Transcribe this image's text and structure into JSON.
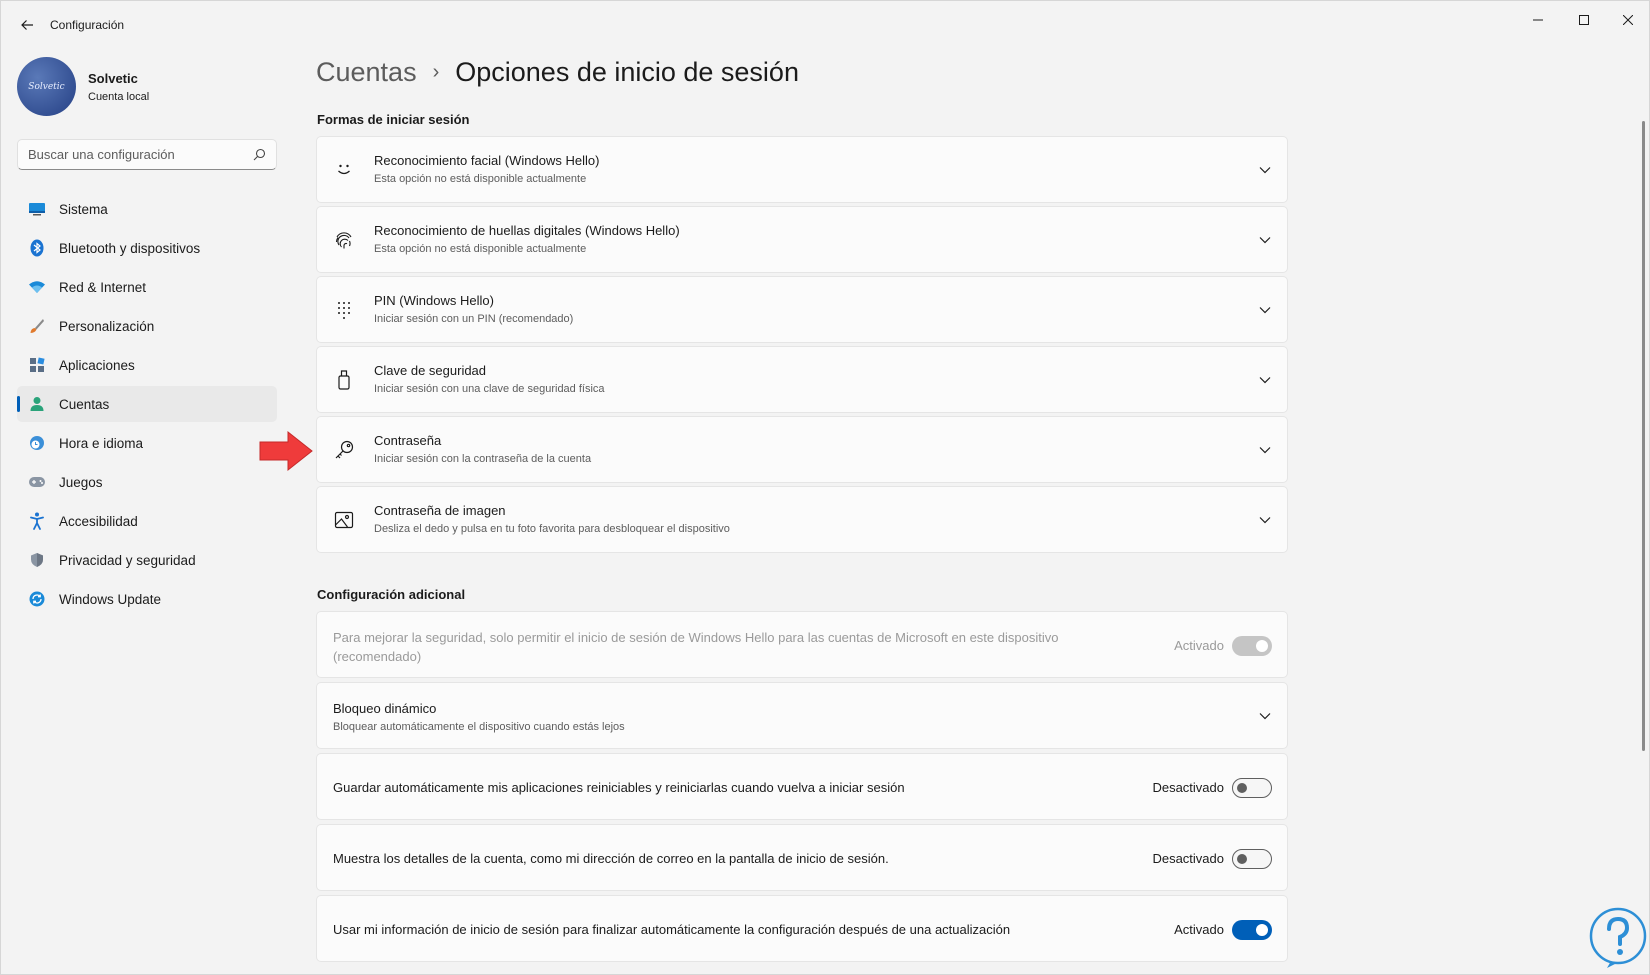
{
  "window": {
    "title": "Configuración"
  },
  "profile": {
    "name": "Solvetic",
    "subtitle": "Cuenta local",
    "avatar_text": "Solvetic"
  },
  "search": {
    "placeholder": "Buscar una configuración"
  },
  "nav": {
    "items": [
      {
        "label": "Sistema",
        "icon": "monitor-icon"
      },
      {
        "label": "Bluetooth y dispositivos",
        "icon": "bluetooth-icon"
      },
      {
        "label": "Red & Internet",
        "icon": "wifi-icon"
      },
      {
        "label": "Personalización",
        "icon": "brush-icon"
      },
      {
        "label": "Aplicaciones",
        "icon": "apps-icon"
      },
      {
        "label": "Cuentas",
        "icon": "person-icon",
        "active": true
      },
      {
        "label": "Hora e idioma",
        "icon": "clock-globe-icon"
      },
      {
        "label": "Juegos",
        "icon": "gamepad-icon"
      },
      {
        "label": "Accesibilidad",
        "icon": "accessibility-icon"
      },
      {
        "label": "Privacidad y seguridad",
        "icon": "shield-icon"
      },
      {
        "label": "Windows Update",
        "icon": "update-icon"
      }
    ]
  },
  "breadcrumb": {
    "parent": "Cuentas",
    "separator": "›",
    "current": "Opciones de inicio de sesión"
  },
  "sections": {
    "signin_ways": "Formas de iniciar sesión",
    "additional": "Configuración adicional"
  },
  "signin_options": [
    {
      "title": "Reconocimiento facial (Windows Hello)",
      "subtitle": "Esta opción no está disponible actualmente",
      "icon": "smiley-face-icon"
    },
    {
      "title": "Reconocimiento de huellas digitales (Windows Hello)",
      "subtitle": "Esta opción no está disponible actualmente",
      "icon": "fingerprint-icon"
    },
    {
      "title": "PIN (Windows Hello)",
      "subtitle": "Iniciar sesión con un PIN (recomendado)",
      "icon": "keypad-icon"
    },
    {
      "title": "Clave de seguridad",
      "subtitle": "Iniciar sesión con una clave de seguridad física",
      "icon": "usb-key-icon"
    },
    {
      "title": "Contraseña",
      "subtitle": "Iniciar sesión con la contraseña de la cuenta",
      "icon": "key-icon"
    },
    {
      "title": "Contraseña de imagen",
      "subtitle": "Desliza el dedo y pulsa en tu foto favorita para desbloquear el dispositivo",
      "icon": "picture-icon"
    }
  ],
  "additional_settings": {
    "hello_only": {
      "text": "Para mejorar la seguridad, solo permitir el inicio de sesión de Windows Hello para las cuentas de Microsoft en este dispositivo",
      "text2": "(recomendado)",
      "state": "Activado"
    },
    "dynamic_lock": {
      "title": "Bloqueo dinámico",
      "subtitle": "Bloquear automáticamente el dispositivo cuando estás lejos"
    },
    "restart_apps": {
      "text": "Guardar automáticamente mis aplicaciones reiniciables y reiniciarlas cuando vuelva a iniciar sesión",
      "state": "Desactivado"
    },
    "account_details": {
      "text": "Muestra los detalles de la cuenta, como mi dirección de correo en la pantalla de inicio de sesión.",
      "state": "Desactivado"
    },
    "finish_setup": {
      "text": "Usar mi información de inicio de sesión para finalizar automáticamente la configuración después de una actualización",
      "state": "Activado"
    }
  },
  "colors": {
    "accent": "#005fb8",
    "annotation_arrow": "#ef3b3b",
    "watermark": "#2d8fd6"
  }
}
